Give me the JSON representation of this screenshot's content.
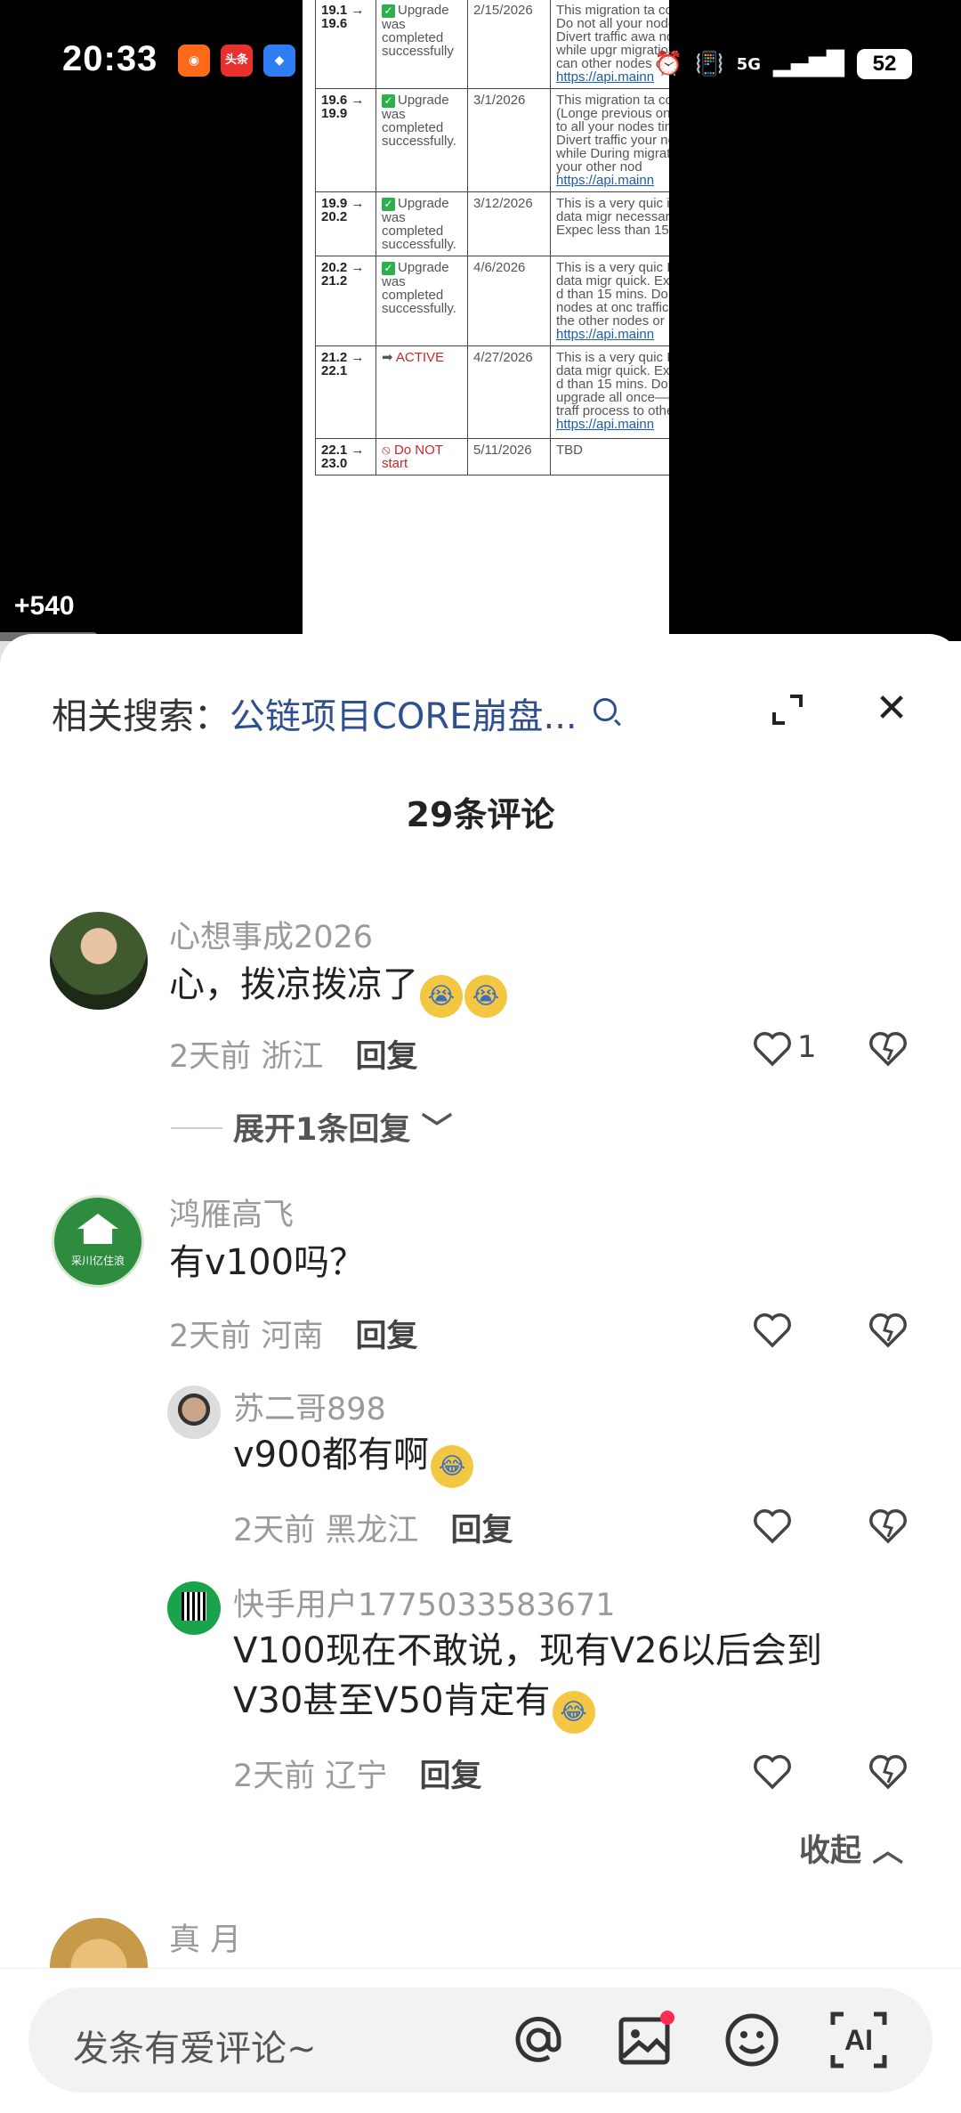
{
  "status_bar": {
    "time": "20:33",
    "app_icons": [
      "kuaishou-icon",
      "toutiao-icon",
      "app-icon"
    ],
    "toutiao_label": "头条",
    "network": "5G",
    "battery": "52"
  },
  "video": {
    "reward_text": "+540",
    "table_rows": [
      {
        "version": "19.1 → 19.6",
        "status": "Upgrade was completed successfully",
        "date": "2/15/2026",
        "notes": "This migration ta complete. Do not all your nodes at Divert traffic awa nodes while upgr migration you can other nodes or to",
        "link": "https://api.mainn"
      },
      {
        "version": "19.6 → 19.9",
        "status": "Upgrade was completed successfully.",
        "date": "3/1/2026",
        "notes": "This migration ta complete. (Longe previous one.) Do to all your nodes time. Divert traffic your nodes while During migration to your other nod",
        "link": "https://api.mainn"
      },
      {
        "version": "19.9 → 20.2",
        "status": "Upgrade was completed successfully.",
        "date": "3/12/2026",
        "notes": "This is a very quic internal data migr necessary. Expec less than 15 mins.",
        "link": ""
      },
      {
        "version": "20.2 → 21.2",
        "status": "Upgrade was completed successfully.",
        "date": "4/6/2026",
        "notes": "This is a very quic Internal data migr quick. Expected d than 15 mins. Do your nodes at onc traffic during the other nodes or",
        "link": "https://api.mainn"
      },
      {
        "version": "21.2 → 22.1",
        "status": "ACTIVE",
        "date": "4/27/2026",
        "notes": "This is a very quic Internal data migr quick. Expected d than 15 mins. Don't upgrade all once—divert traff process to other",
        "link": "https://api.mainn"
      },
      {
        "version": "22.1 → 23.0",
        "status": "Do NOT start",
        "date": "5/11/2026",
        "notes": "TBD",
        "link": ""
      }
    ]
  },
  "sheet": {
    "related_prefix": "相关搜索：",
    "related_keyword": "公链项目CORE崩盘...",
    "comment_count": "29条评论",
    "expand_replies": "展开1条回复",
    "collapse": "收起",
    "comments": [
      {
        "user": "心想事成2026",
        "text": "心，拨凉拨凉了",
        "time": "2天前",
        "region": "浙江",
        "reply": "回复",
        "likes": "1"
      },
      {
        "user": "鸿雁高飞",
        "text": "有v100吗？",
        "time": "2天前",
        "region": "河南",
        "reply": "回复",
        "likes": ""
      },
      {
        "user": "苏二哥898",
        "text": "v900都有啊",
        "time": "2天前",
        "region": "黑龙江",
        "reply": "回复",
        "likes": ""
      },
      {
        "user": "快手用户1775033583671",
        "text_line1": "V100现在不敢说，现有V26以后会到",
        "text_line2": "V30甚至V50肯定有",
        "time": "2天前",
        "region": "辽宁",
        "reply": "回复",
        "likes": ""
      },
      {
        "user": "真 月"
      }
    ],
    "avatar2_text": "采川亿住浪"
  },
  "input_bar": {
    "placeholder": "发条有爱评论~",
    "icons": [
      "at-icon",
      "image-icon",
      "emoji-icon",
      "ai-icon"
    ],
    "ai_label": "AI"
  }
}
